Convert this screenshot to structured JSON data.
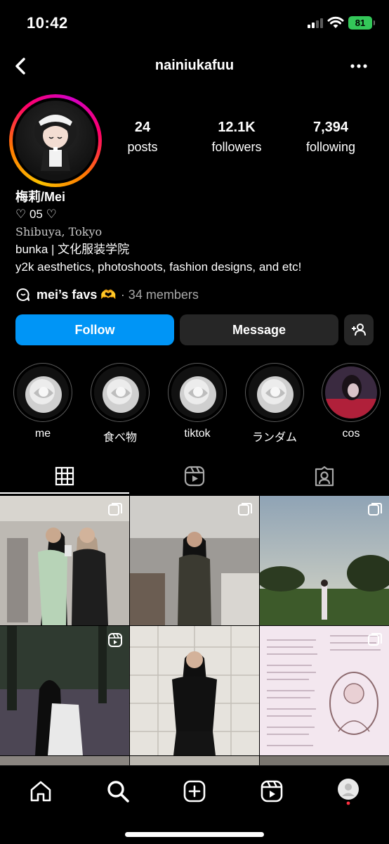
{
  "status_bar": {
    "time": "10:42",
    "battery": "81"
  },
  "header": {
    "username": "nainiukafuu"
  },
  "stats": [
    {
      "value": "24",
      "label": "posts"
    },
    {
      "value": "12.1K",
      "label": "followers"
    },
    {
      "value": "7,394",
      "label": "following"
    }
  ],
  "bio": {
    "name": "梅莉/Mei",
    "line1": "♡ 05 ♡",
    "line2": "Shibuya, Tokyo",
    "line3": "bunka | 文化服装学院",
    "line4": "y2k aesthetics, photoshoots, fashion designs, and etc!"
  },
  "channel": {
    "name": "mei’s favs 🫶",
    "members": "· 34 members"
  },
  "buttons": {
    "follow": "Follow",
    "message": "Message"
  },
  "highlights": [
    {
      "label": "me"
    },
    {
      "label": "食べ物"
    },
    {
      "label": "tiktok"
    },
    {
      "label": "ランダム"
    },
    {
      "label": "cos"
    }
  ],
  "tabs": [
    "grid",
    "reels",
    "tagged"
  ],
  "colors": {
    "accent": "#0095f6",
    "button_dark": "#262626",
    "notification_dot": "#ff3040"
  }
}
